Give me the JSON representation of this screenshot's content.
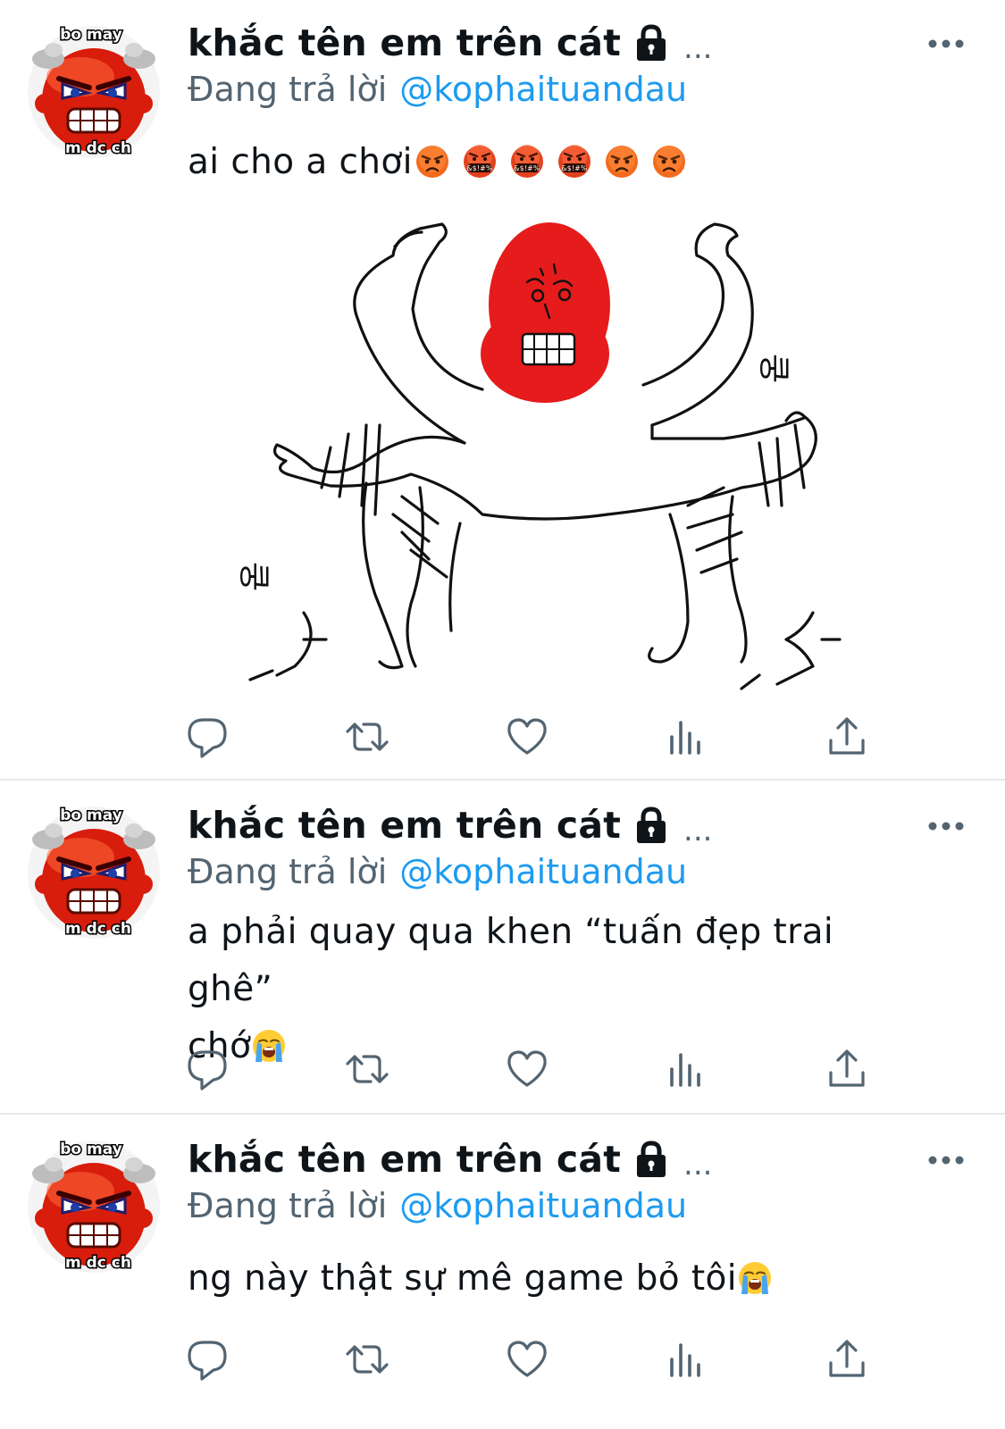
{
  "tweets": [
    {
      "avatar": {
        "top_text": "bo may",
        "bottom_text": "m dc ch"
      },
      "display_name": "khắc tên em trên cát",
      "lock_icon": "lock-icon",
      "truncation": "...",
      "more_icon": "more-horizontal-icon",
      "reply_prefix": "Đang trả lời",
      "reply_handle": "@kophaituandau",
      "text": "ai cho a chơi",
      "emojis": [
        "angry-face",
        "cursing-face",
        "cursing-face",
        "cursing-face",
        "angry-face",
        "angry-face"
      ],
      "media": {
        "caption_left": "쿵",
        "caption_right": "쿵"
      }
    },
    {
      "avatar": {
        "top_text": "bo may",
        "bottom_text": "m dc ch"
      },
      "display_name": "khắc tên em trên cát",
      "lock_icon": "lock-icon",
      "truncation": "...",
      "more_icon": "more-horizontal-icon",
      "reply_prefix": "Đang trả lời",
      "reply_handle": "@kophaituandau",
      "text_line1": "a phải quay qua khen “tuấn đẹp trai ghê”",
      "text_line2": "chớ",
      "emojis": [
        "loudly-crying-face"
      ]
    },
    {
      "avatar": {
        "top_text": "bo may",
        "bottom_text": "m dc ch"
      },
      "display_name": "khắc tên em trên cát",
      "lock_icon": "lock-icon",
      "truncation": "...",
      "more_icon": "more-horizontal-icon",
      "reply_prefix": "Đang trả lời",
      "reply_handle": "@kophaituandau",
      "text": "ng này thật sự mê game bỏ tôi",
      "emojis": [
        "loudly-crying-face"
      ]
    }
  ],
  "action_icons": [
    "reply-icon",
    "retweet-icon",
    "like-icon",
    "views-icon",
    "share-icon"
  ],
  "colors": {
    "text": "#0f1419",
    "secondary": "#536471",
    "link": "#1d9bf0",
    "divider": "#e6e9ec",
    "icon": "#536471"
  }
}
